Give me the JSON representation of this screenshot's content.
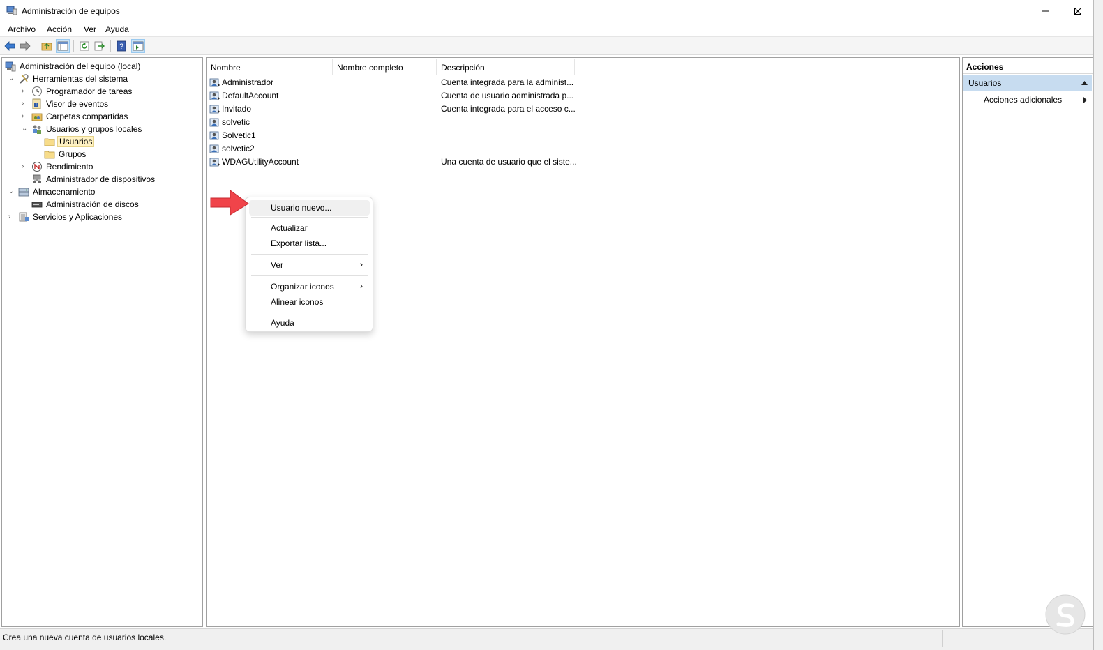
{
  "window": {
    "title": "Administración de equipos"
  },
  "menu": [
    "Archivo",
    "Acción",
    "Ver",
    "Ayuda"
  ],
  "tree": {
    "root": "Administración del equipo (local)",
    "system_tools": "Herramientas del sistema",
    "task_scheduler": "Programador de tareas",
    "event_viewer": "Visor de eventos",
    "shared_folders": "Carpetas compartidas",
    "local_users_groups": "Usuarios y grupos locales",
    "users": "Usuarios",
    "groups": "Grupos",
    "performance": "Rendimiento",
    "device_manager": "Administrador de dispositivos",
    "storage": "Almacenamiento",
    "disk_management": "Administración de discos",
    "services_apps": "Servicios y Aplicaciones"
  },
  "list": {
    "columns": [
      "Nombre",
      "Nombre completo",
      "Descripción"
    ],
    "rows": [
      {
        "name": "Administrador",
        "description": "Cuenta integrada para la administ..."
      },
      {
        "name": "DefaultAccount",
        "description": "Cuenta de usuario administrada p..."
      },
      {
        "name": "Invitado",
        "description": "Cuenta integrada para el acceso c..."
      },
      {
        "name": "solvetic",
        "description": ""
      },
      {
        "name": "Solvetic1",
        "description": ""
      },
      {
        "name": "solvetic2",
        "description": ""
      },
      {
        "name": "WDAGUtilityAccount",
        "description": "Una cuenta de usuario que el siste..."
      }
    ]
  },
  "context_menu": {
    "new_user": "Usuario nuevo...",
    "refresh": "Actualizar",
    "export_list": "Exportar lista...",
    "view": "Ver",
    "arrange_icons": "Organizar iconos",
    "line_up_icons": "Alinear iconos",
    "help": "Ayuda"
  },
  "actions": {
    "title": "Acciones",
    "section": "Usuarios",
    "more": "Acciones adicionales"
  },
  "status": "Crea una nueva cuenta de usuarios locales.",
  "colors": {
    "accent_arrow": "#f0444a",
    "section_bg": "#c7dcf0",
    "selection_bg": "#fff2c4"
  }
}
